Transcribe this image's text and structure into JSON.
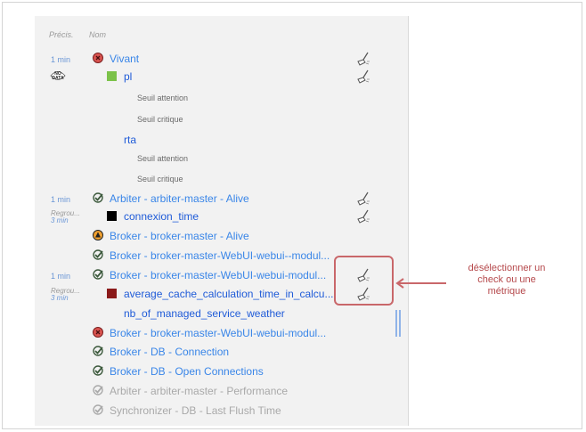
{
  "header": {
    "col_precision": "Précis.",
    "col_name": "Nom"
  },
  "rows": [
    {
      "prec": "1 min",
      "name": "Vivant"
    },
    {
      "nodata_label": "NO DATA",
      "name": "pl"
    },
    {
      "name": "Seuil attention"
    },
    {
      "name": "Seuil critique"
    },
    {
      "name": "rta"
    },
    {
      "name": "Seuil attention"
    },
    {
      "name": "Seuil critique"
    },
    {
      "prec": "1 min",
      "name": "Arbiter - arbiter-master - Alive"
    },
    {
      "prec": "Regrou...",
      "prec2": "3 min",
      "name": "connexion_time"
    },
    {
      "name": "Broker - broker-master - Alive"
    },
    {
      "name": "Broker - broker-master-WebUI-webui--modul..."
    },
    {
      "prec": "1 min",
      "name": "Broker - broker-master-WebUI-webui-modul..."
    },
    {
      "prec": "Regrou...",
      "prec2": "3 min",
      "name": "average_cache_calculation_time_in_calcu..."
    },
    {
      "name": "nb_of_managed_service_weather"
    },
    {
      "name": "Broker - broker-master-WebUI-webui-modul..."
    },
    {
      "name": "Broker - DB - Connection"
    },
    {
      "name": "Broker - DB - Open Connections"
    },
    {
      "name": "Arbiter - arbiter-master - Performance"
    },
    {
      "name": "Synchronizer - DB - Last Flush Time"
    }
  ],
  "annotation": {
    "line1": "désélectionner un",
    "line2": "check ou une",
    "line3": "métrique"
  },
  "colors": {
    "link": "#3a86e8",
    "link_dark": "#1f5bd8",
    "status_critical": "#d9534f",
    "status_ok": "#3d8a3d",
    "status_warning": "#f0a030",
    "metric_green": "#7cc24a",
    "metric_dark_red": "#8b1a1a",
    "annotation_red": "#c9676a"
  },
  "icons": {
    "critical": "critical-status-icon",
    "ok": "ok-status-check-icon",
    "warning": "warning-status-icon",
    "brush": "broom-icon"
  }
}
